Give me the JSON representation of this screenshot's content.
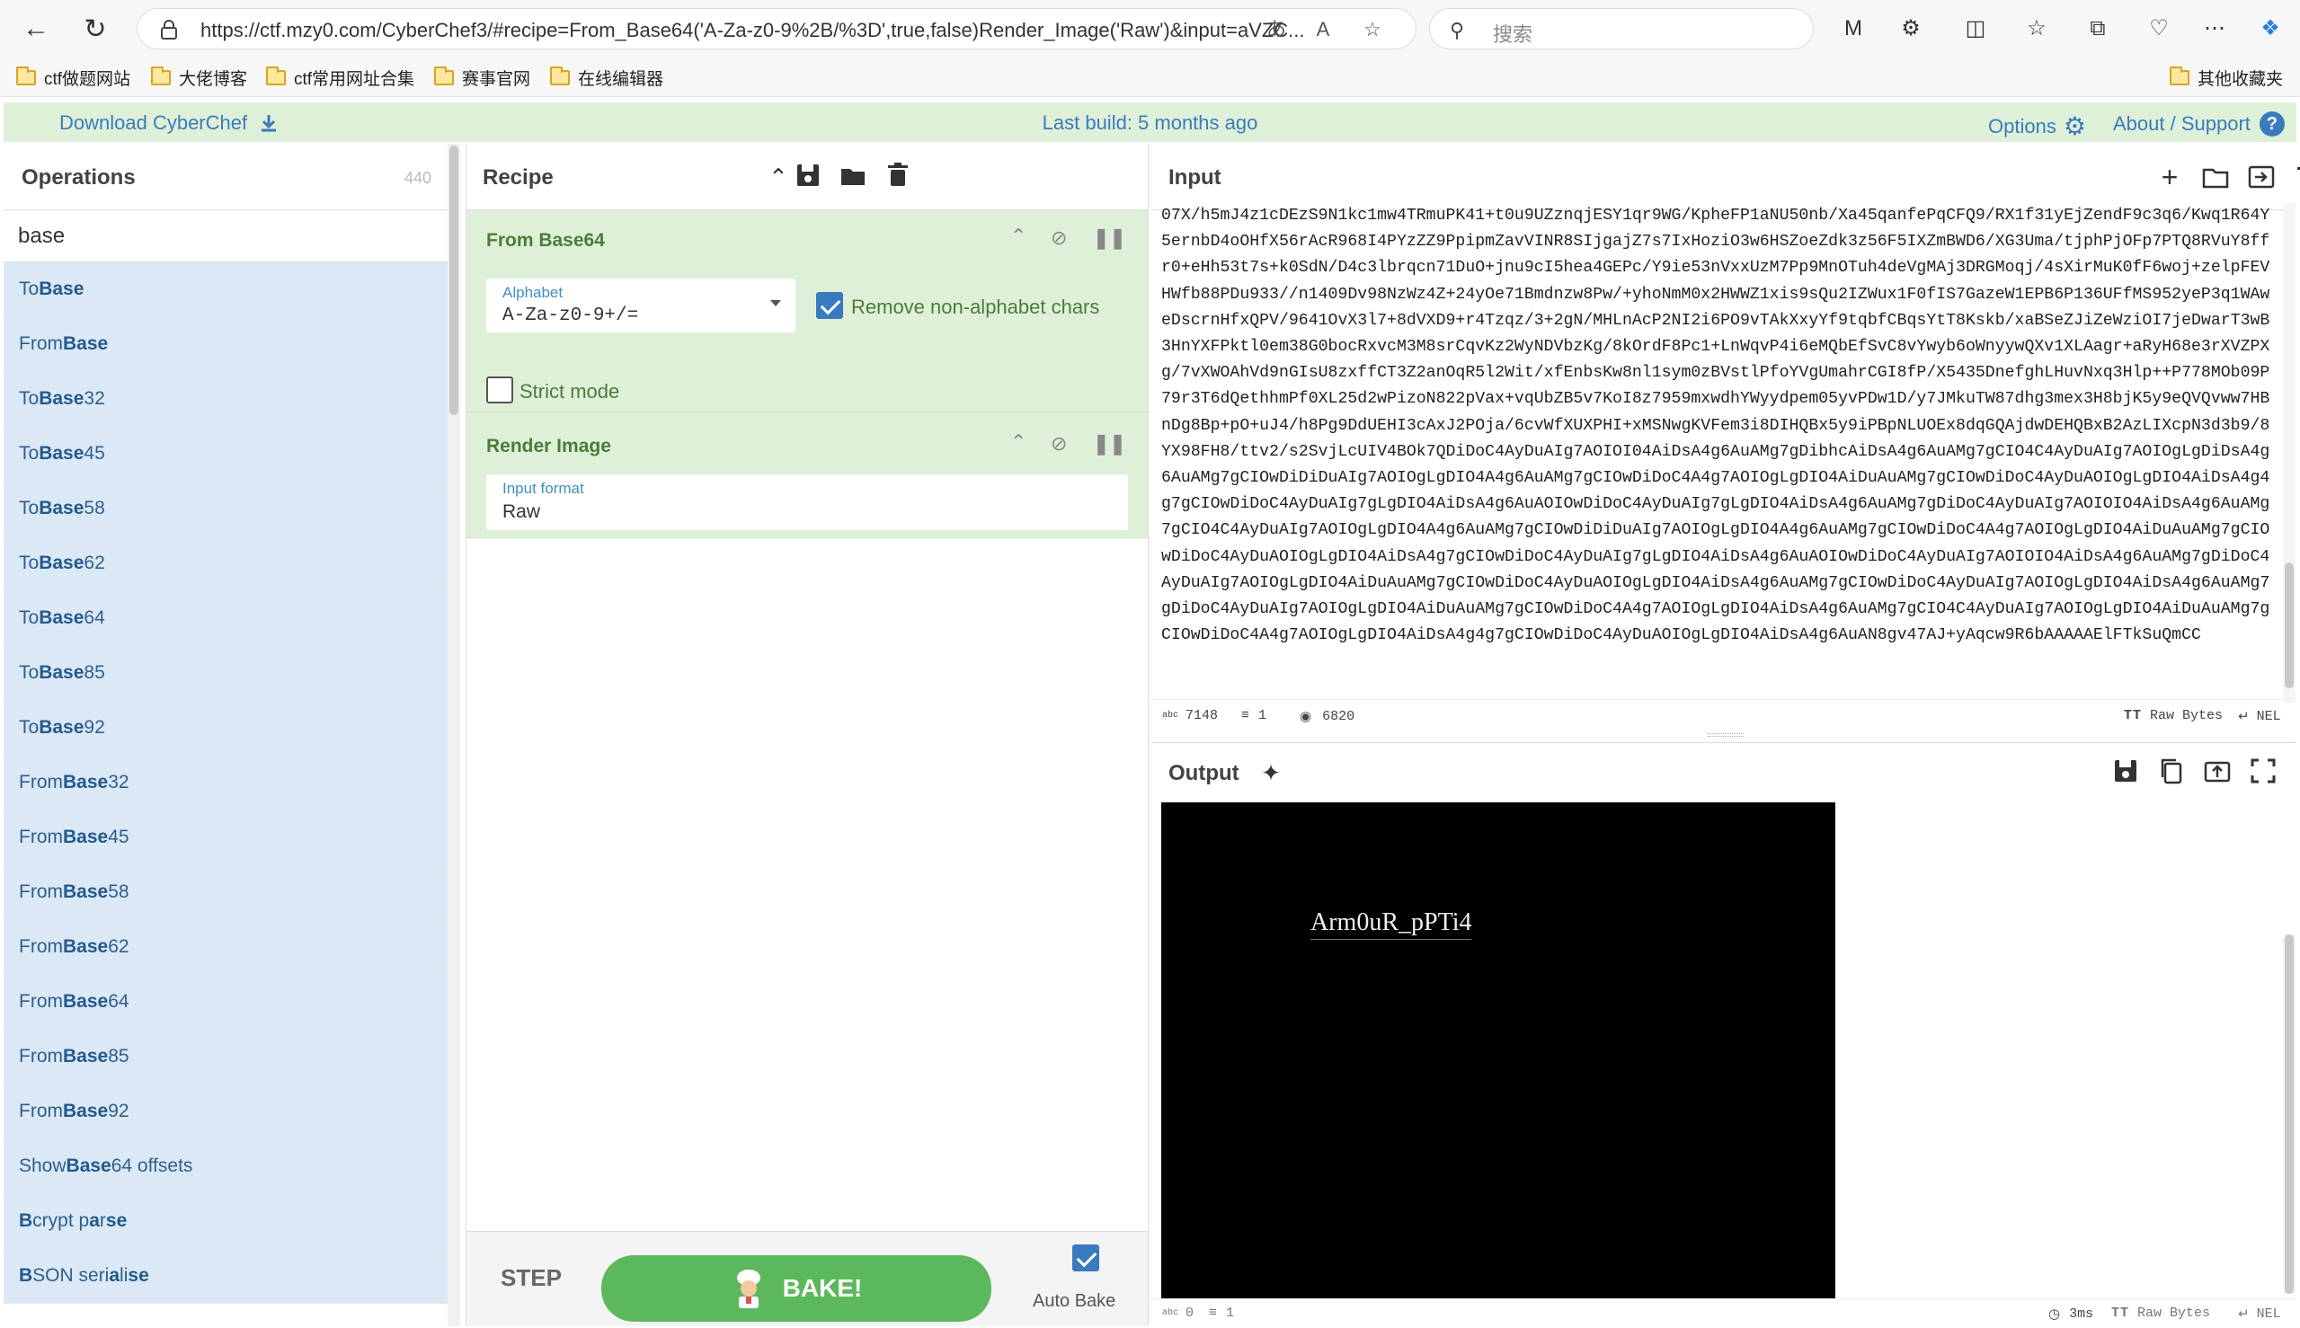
{
  "browser": {
    "url": "https://ctf.mzy0.com/CyberChef3/#recipe=From_Base64('A-Za-z0-9%2B/%3D',true,false)Render_Image('Raw')&input=aVZC...",
    "search_placeholder": "搜索"
  },
  "bookmarks": [
    "ctf做题网站",
    "大佬博客",
    "ctf常用网址合集",
    "赛事官网",
    "在线编辑器"
  ],
  "bookmarks_other": "其他收藏夹",
  "banner": {
    "download": "Download CyberChef",
    "last_build": "Last build: 5 months ago",
    "options": "Options",
    "about": "About / Support"
  },
  "operations": {
    "title": "Operations",
    "count": "440",
    "search_value": "base",
    "items": [
      {
        "pre": "To ",
        "hl": "Base",
        "post": ""
      },
      {
        "pre": "From ",
        "hl": "Base",
        "post": ""
      },
      {
        "pre": "To ",
        "hl": "Base",
        "post": "32"
      },
      {
        "pre": "To ",
        "hl": "Base",
        "post": "45"
      },
      {
        "pre": "To ",
        "hl": "Base",
        "post": "58"
      },
      {
        "pre": "To ",
        "hl": "Base",
        "post": "62"
      },
      {
        "pre": "To ",
        "hl": "Base",
        "post": "64"
      },
      {
        "pre": "To ",
        "hl": "Base",
        "post": "85"
      },
      {
        "pre": "To ",
        "hl": "Base",
        "post": "92"
      },
      {
        "pre": "From ",
        "hl": "Base",
        "post": "32"
      },
      {
        "pre": "From ",
        "hl": "Base",
        "post": "45"
      },
      {
        "pre": "From ",
        "hl": "Base",
        "post": "58"
      },
      {
        "pre": "From ",
        "hl": "Base",
        "post": "62"
      },
      {
        "pre": "From ",
        "hl": "Base",
        "post": "64"
      },
      {
        "pre": "From ",
        "hl": "Base",
        "post": "85"
      },
      {
        "pre": "From ",
        "hl": "Base",
        "post": "92"
      },
      {
        "pre": "Show ",
        "hl": "Base",
        "post": "64 offsets"
      },
      {
        "pre": "",
        "hl": "B",
        "post": "crypt p",
        "hl2": "a",
        "post2": "r",
        "hl3": "se",
        "post3": ""
      },
      {
        "pre": "",
        "hl": "B",
        "post": "SON seri",
        "hl2": "a",
        "post2": "li",
        "hl3": "se",
        "post3": ""
      }
    ]
  },
  "recipe": {
    "title": "Recipe",
    "op1": {
      "title": "From Base64",
      "alphabet_label": "Alphabet",
      "alphabet_value": "A-Za-z0-9+/=",
      "remove_nonalpha": "Remove non-alphabet chars",
      "remove_checked": true,
      "strict": "Strict mode",
      "strict_checked": false
    },
    "op2": {
      "title": "Render Image",
      "format_label": "Input format",
      "format_value": "Raw"
    },
    "step": "STEP",
    "bake": "BAKE!",
    "auto_bake": "Auto Bake",
    "auto_bake_checked": true
  },
  "input": {
    "title": "Input",
    "text": "07X/h5mJ4z1cDEzS9N1kc1mw4TRmuPK41+t0u9UZznqjESY1qr9WG/KpheFP1aNU50nb/Xa45qanfePqCFQ9/RX1f31yEjZendF9c3q6/Kwq1R64Y5ernbD4oOHfX56rAcR968I4PYzZZ9PpipmZavVINR8SIjgajZ7s7IxHoziO3w6HSZoeZdk3z56F5IXZmBWD6/XG3Uma/tjphPjOFp7PTQ8RVuY8ffr0+eHh53t7s+k0SdN/D4c3lbrqcn71DuO+jnu9cI5hea4GEPc/Y9ie53nVxxUzM7Pp9MnOTuh4deVgMAj3DRGMoqj/4sXirMuK0fF6woj+zelpFEVHWfb88PDu933//n1409Dv98NzWz4Z+24yOe71Bmdnzw8Pw/+yhoNmM0x2HWWZ1xis9sQu2IZWux1F0fIS7GazeW1EPB6P136UFfMS952yeP3q1WAweDscrnHfxQPV/9641OvX3l7+8dVXD9+r4Tzqz/3+2gN/MHLnAcP2NI2i6PO9vTAkXxyYf9tqbfCBqsYtT8Kskb/xaBSeZJiZeWziOI7jeDwarT3wB3HnYXFPktl0em38G0bocRxvcM3M8srCqvKz2WyNDVbzKg/8kOrdF8Pc1+LnWqvP4i6eMQbEfSvC8vYwyb6oWnyywQXv1XLAagr+aRyH68e3rXVZPXg/7vXWOAhVd9nGIsU8zxffCT3Z2anOqR5l2Wit/xfEnbsKw8nl1sym0zBVstlPfoYVgUmahrCGI8fP/X5435DnefghLHuvNxq3Hlp++P778MOb09P79r3T6dQethhmPf0XL25d2wPizoN822pVax+vqUbZB5v7KoI8z7959mxwdhYWyydpem05yvPDw1D/y7JMkuTW87dhg3mex3H8bjK5y9eQVQvww7HBnDg8Bp+pO+uJ4/h8Pg9DdUEHI3cAxJ2POja/6cvWfXUXPHI+xMSNwgKVFem3i8DIHQBx5y9iPBpNLUOEx8dqGQAjdwDEHQBxB2AzLIXcpN3d3b9/8YX98FH8/ttv2/s2SvjLcUIV4BOk7QDiDoC4AyDuAIg7AOIOI04AiDsA4g6AuAMg7gDibhcAiDsA4g6AuAMg7gCIO4C4AyDuAIg7AOIOgLgDiDsA4g6AuAMg7gCIOwDiDiDuAIg7AOIOgLgDIO4A4g6AuAMg7gCIOwDiDoC4A4g7AOIOgLgDIO4AiDuAuAMg7gCIOwDiDoC4AyDuAOIOgLgDIO4AiDsA4g4g7gCIOwDiDoC4AyDuAIg7gLgDIO4AiDsA4g6AuAOIOwDiDoC4AyDuAIg7gLgDIO4AiDsA4g6AuAMg7gDiDoC4AyDuAIg7AOIOIO4AiDsA4g6AuAMg7gCIO4C4AyDuAIg7AOIOgLgDIO4A4g6AuAMg7gCIOwDiDiDuAIg7AOIOgLgDIO4A4g6AuAMg7gCIOwDiDoC4A4g7AOIOgLgDIO4AiDuAuAMg7gCIOwDiDoC4AyDuAOIOgLgDIO4AiDsA4g7gCIOwDiDoC4AyDuAIg7gLgDIO4AiDsA4g6AuAOIOwDiDoC4AyDuAIg7AOIOIO4AiDsA4g6AuAMg7gDiDoC4AyDuAIg7AOIOgLgDIO4AiDuAuAMg7gCIOwDiDoC4AyDuAOIOgLgDIO4AiDsA4g6AuAMg7gCIOwDiDoC4AyDuAIg7AOIOgLgDIO4AiDsA4g6AuAMg7gDiDoC4AyDuAIg7AOIOgLgDIO4AiDuAuAMg7gCIOwDiDoC4A4g7AOIOgLgDIO4AiDsA4g6AuAMg7gCIO4C4AyDuAIg7AOIOgLgDIO4AiDuAuAMg7gCIOwDiDoC4A4g7AOIOgLgDIO4AiDsA4g4g7gCIOwDiDoC4AyDuAOIOgLgDIO4AiDsA4g6AuAN8gv47AJ+yAqcw9R6bAAAAAElFTkSuQmCC",
    "stat_chars": "7148",
    "stat_lines": "1",
    "stat_pos": "6820",
    "raw_bytes": "Raw Bytes",
    "eol": "NEL"
  },
  "output": {
    "title": "Output",
    "image_text": "Arm0uR_pPTi4",
    "stat_chars": "0",
    "stat_lines": "1",
    "time": "3ms",
    "raw_bytes": "Raw Bytes",
    "eol": "NEL"
  },
  "colors": {
    "banner_bg": "#dff0d8",
    "op_bg": "#dbe8f5",
    "bake_green": "#5cb85c",
    "link_blue": "#3a7bbf"
  }
}
